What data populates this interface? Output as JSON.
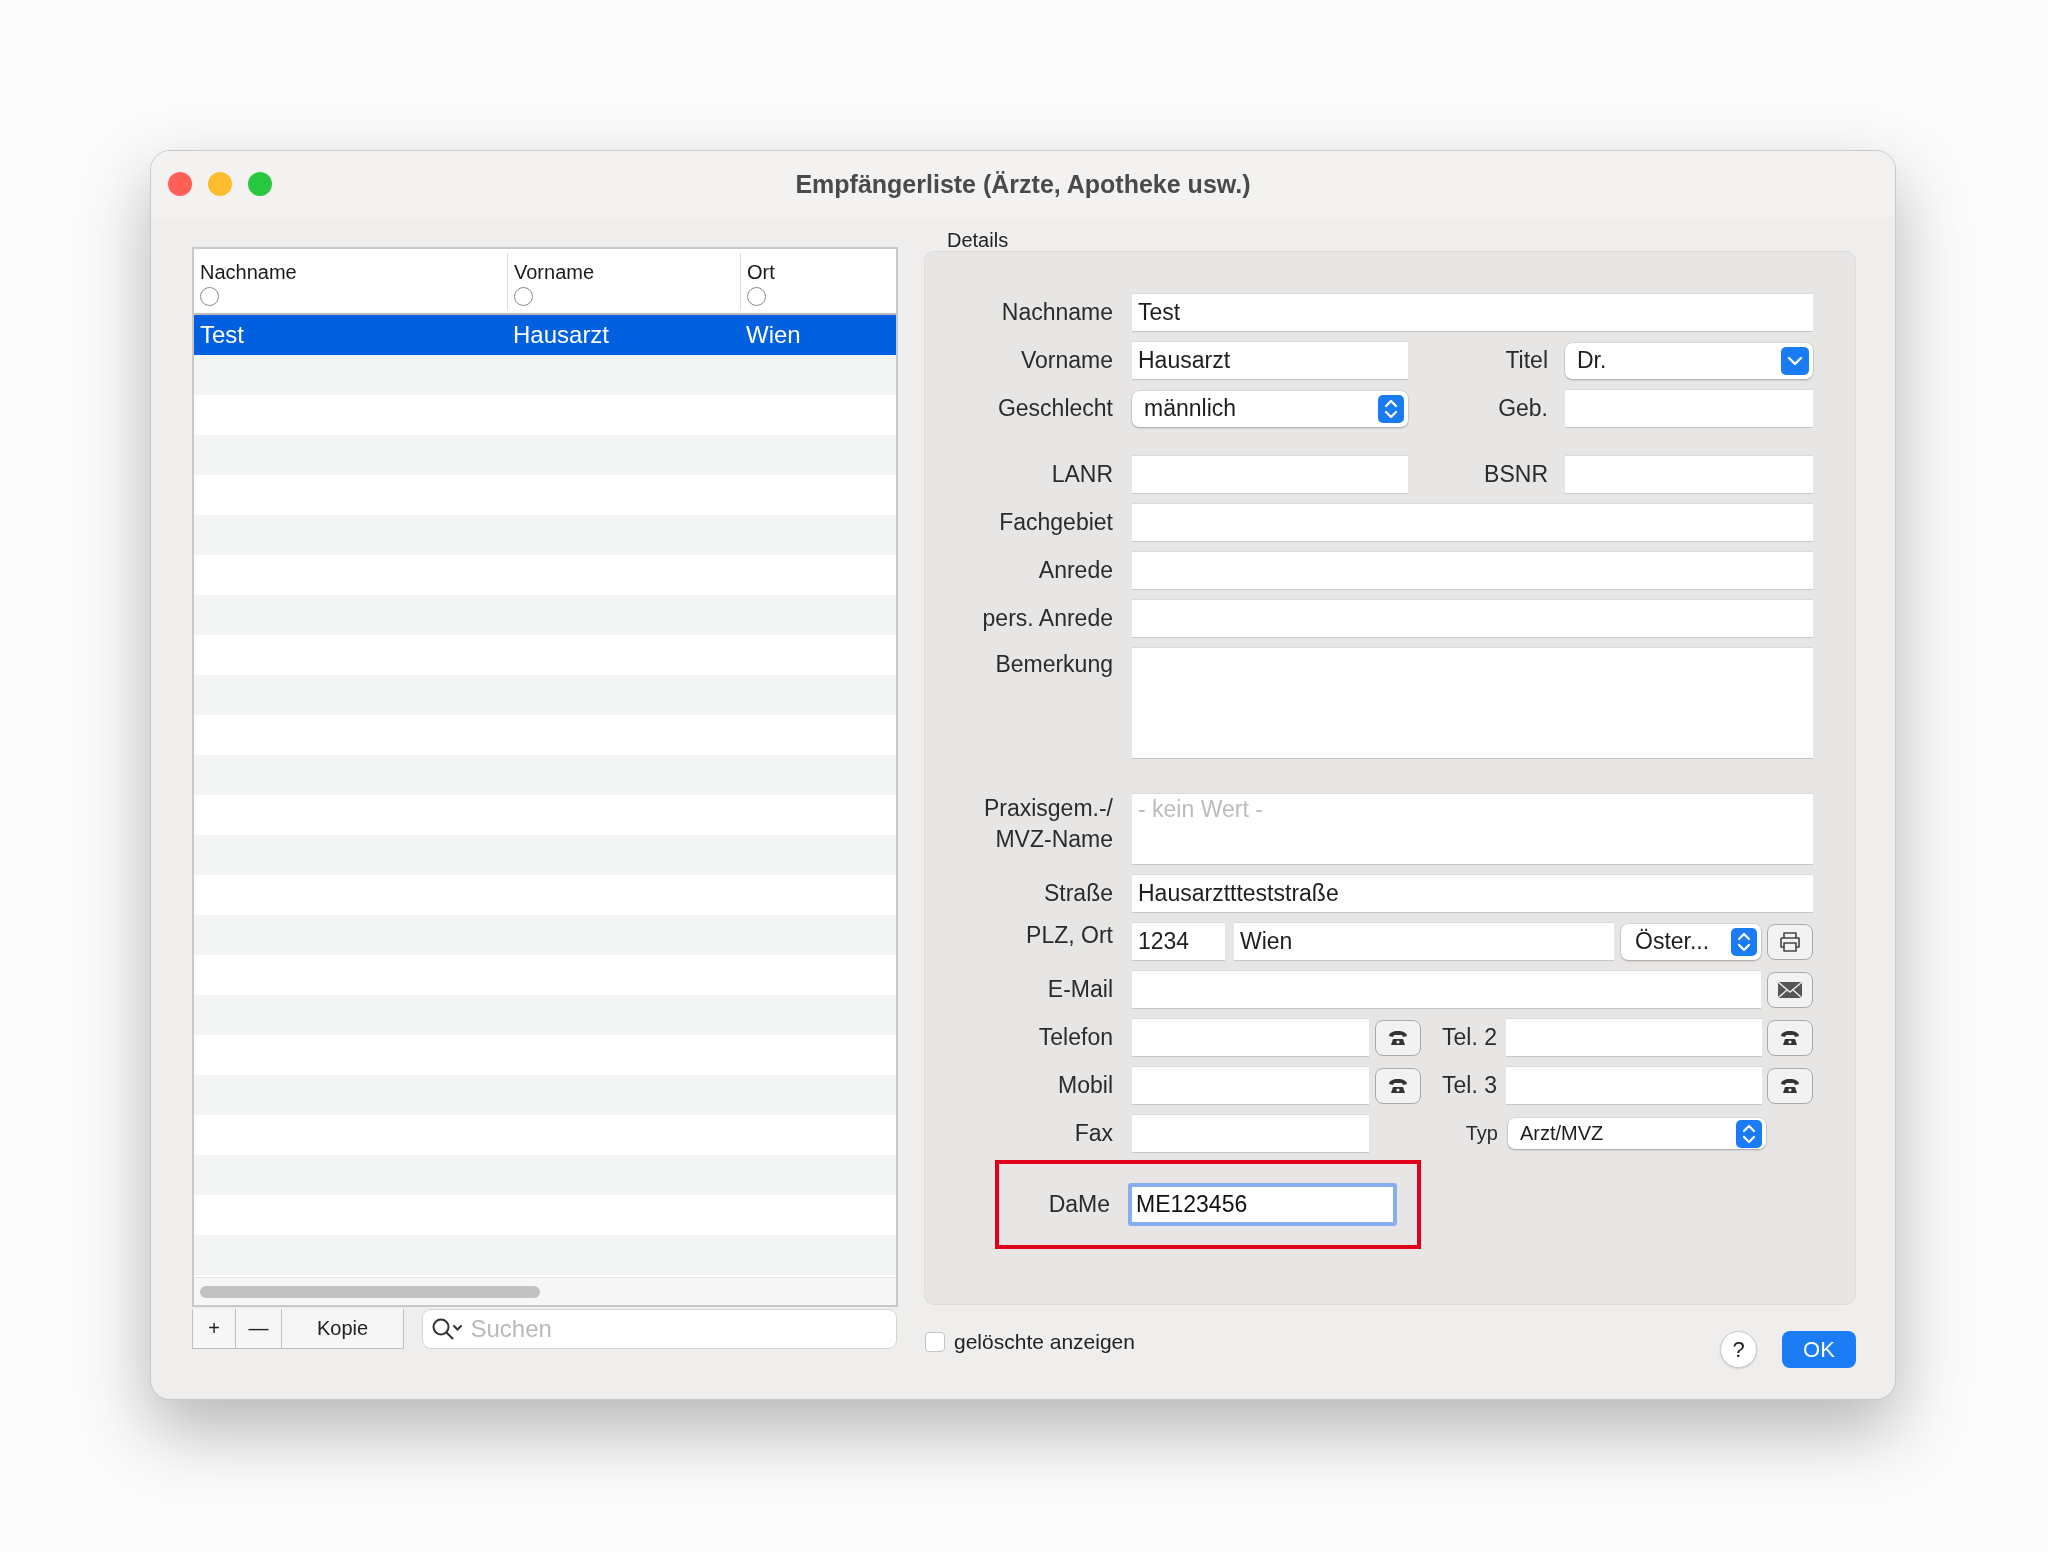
{
  "window": {
    "title": "Empfängerliste (Ärzte, Apotheke usw.)"
  },
  "table": {
    "columns": [
      {
        "label": "Nachname"
      },
      {
        "label": "Vorname"
      },
      {
        "label": "Ort"
      }
    ],
    "rows": [
      {
        "cells": [
          "Test",
          "Hausarzt",
          "Wien"
        ],
        "selected": true
      }
    ]
  },
  "list_toolbar": {
    "add": "+",
    "remove": "—",
    "copy": "Kopie"
  },
  "search": {
    "placeholder": "Suchen"
  },
  "details": {
    "title": "Details",
    "nachname": {
      "label": "Nachname",
      "value": "Test"
    },
    "vorname": {
      "label": "Vorname",
      "value": "Hausarzt"
    },
    "titel": {
      "label": "Titel",
      "value": "Dr."
    },
    "geschlecht": {
      "label": "Geschlecht",
      "value": "männlich"
    },
    "geb": {
      "label": "Geb."
    },
    "lanr": {
      "label": "LANR"
    },
    "bsnr": {
      "label": "BSNR"
    },
    "fachgebiet": {
      "label": "Fachgebiet"
    },
    "anrede": {
      "label": "Anrede"
    },
    "pers_anrede": {
      "label": "pers. Anrede"
    },
    "bemerkung": {
      "label": "Bemerkung"
    },
    "praxis": {
      "label_lines": [
        "Praxisgem.-/",
        "MVZ-Name"
      ],
      "placeholder": "- kein Wert -"
    },
    "strasse": {
      "label": "Straße",
      "value": "Hausarzttteststraße"
    },
    "plz_ort": {
      "label": "PLZ, Ort",
      "plz": "1234",
      "ort": "Wien",
      "land": "Öster..."
    },
    "email": {
      "label": "E-Mail"
    },
    "telefon": {
      "label": "Telefon"
    },
    "tel2": {
      "label": "Tel. 2"
    },
    "mobil": {
      "label": "Mobil"
    },
    "tel3": {
      "label": "Tel. 3"
    },
    "fax": {
      "label": "Fax"
    },
    "typ": {
      "label": "Typ",
      "value": "Arzt/MVZ"
    },
    "dame": {
      "label": "DaMe",
      "value": "ME123456",
      "focused": true,
      "highlighted": true
    }
  },
  "show_deleted": {
    "label": "gelöschte anzeigen",
    "checked": false
  },
  "help": "?",
  "ok": "OK"
}
